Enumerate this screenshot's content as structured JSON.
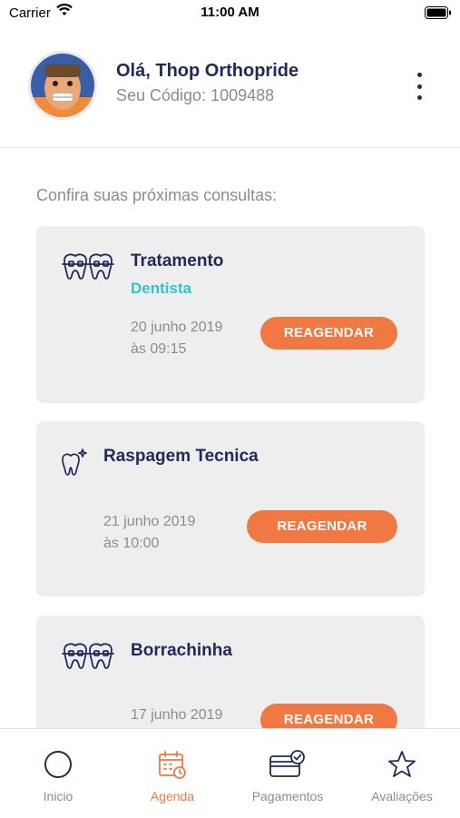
{
  "status_bar": {
    "carrier": "Carrier",
    "time": "11:00 AM"
  },
  "header": {
    "greeting": "Olá, Thop Orthopride",
    "code": "Seu Código: 1009488"
  },
  "section_title": "Confira suas próximas consultas:",
  "appointments": [
    {
      "icon": "braces-teeth-icon",
      "title": "Tratamento",
      "subtitle": "Dentista",
      "date": "20 junho 2019",
      "time": "às 09:15",
      "button": "REAGENDAR"
    },
    {
      "icon": "sparkle-tooth-icon",
      "title": "Raspagem Tecnica",
      "subtitle": "",
      "date": "21 junho 2019",
      "time": "às 10:00",
      "button": "REAGENDAR"
    },
    {
      "icon": "braces-teeth-icon",
      "title": "Borrachinha",
      "subtitle": "",
      "date": "17 junho 2019",
      "time": "",
      "button": "REAGENDAR"
    }
  ],
  "tabs": [
    {
      "label": "Inicio",
      "icon": "circle-icon",
      "active": false
    },
    {
      "label": "Agenda",
      "icon": "calendar-icon",
      "active": true
    },
    {
      "label": "Pagamentos",
      "icon": "card-check-icon",
      "active": false
    },
    {
      "label": "Avaliações",
      "icon": "star-icon",
      "active": false
    }
  ],
  "colors": {
    "primary": "#1f2a5a",
    "accent": "#ef7843",
    "teal": "#2ec4d6",
    "muted": "#8b8b93",
    "card": "#efeeef"
  }
}
